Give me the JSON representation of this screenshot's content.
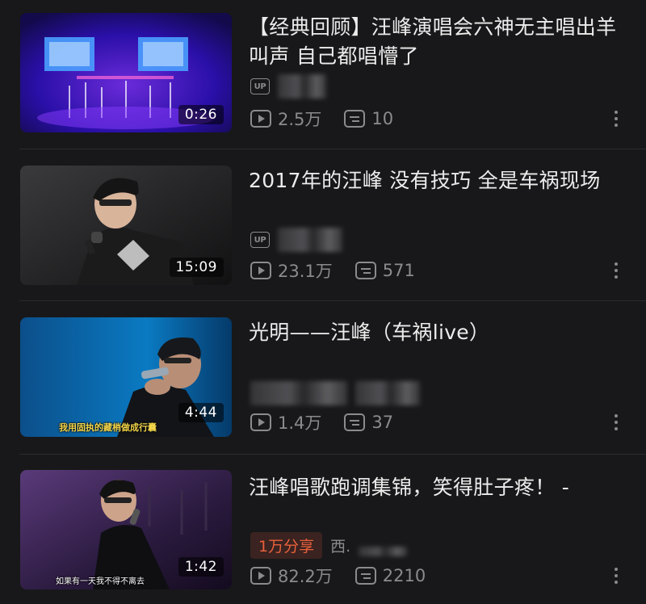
{
  "videos": [
    {
      "title": "【经典回顾】汪峰演唱会六神无主唱出羊叫声  自己都唱懵了",
      "duration": "0:26",
      "uploader_badge": "UP",
      "views": "2.5万",
      "danmaku": "10",
      "thumb_icon": "concert-stage-thumbnail"
    },
    {
      "title": "2017年的汪峰  没有技巧  全是车祸现场",
      "duration": "15:09",
      "uploader_badge": "UP",
      "views": "23.1万",
      "danmaku": "571",
      "thumb_icon": "singer-closeup-thumbnail"
    },
    {
      "title": "光明——汪峰（车祸live）",
      "duration": "4:44",
      "views": "1.4万",
      "danmaku": "37",
      "subtitle": "我用固执的藏梢做成行囊",
      "thumb_icon": "singer-microphone-thumbnail"
    },
    {
      "title": "汪峰唱歌跑调集锦，笑得肚子疼！  -",
      "duration": "1:42",
      "share_badge": "1万分享",
      "uploader_partial": "西.",
      "views": "82.2万",
      "danmaku": "2210",
      "subtitle": "如果有一天我不得不离去",
      "thumb_icon": "stage-performance-thumbnail"
    }
  ],
  "colors": {
    "background": "#18181a",
    "title": "#ececec",
    "meta": "#8b8b8e",
    "share_badge": "#e8603c"
  }
}
